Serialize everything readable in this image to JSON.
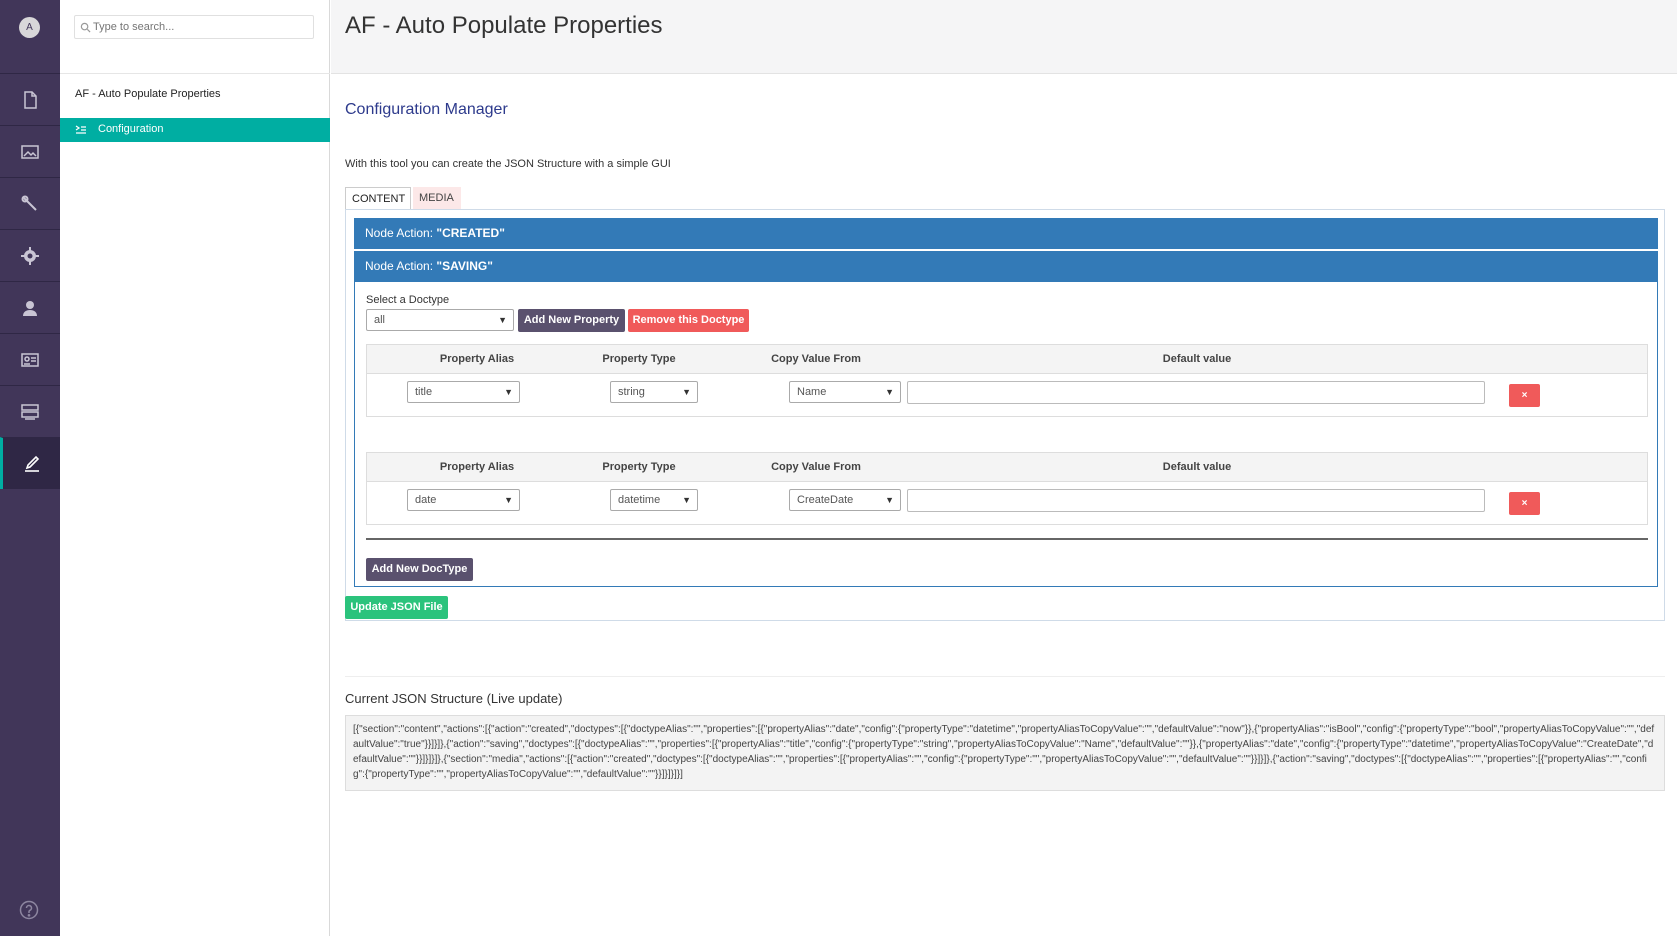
{
  "rail": {
    "avatar_letter": "A",
    "items": [
      {
        "icon": "content-icon"
      },
      {
        "icon": "media-icon"
      },
      {
        "icon": "settings-wrench-icon"
      },
      {
        "icon": "gear-icon"
      },
      {
        "icon": "user-icon"
      },
      {
        "icon": "members-icon"
      },
      {
        "icon": "forms-icon"
      },
      {
        "icon": "edit-pen-icon",
        "active": true
      }
    ],
    "help_icon": "help-icon"
  },
  "tree": {
    "search_placeholder": "Type to search...",
    "root_label": "AF - Auto Populate Properties",
    "active_item_label": "Configuration"
  },
  "header": {
    "title": "AF - Auto Populate Properties"
  },
  "main": {
    "section_title": "Configuration Manager",
    "intro_text": "With this tool you can create the JSON Structure with a simple GUI",
    "tabs": [
      {
        "label": "CONTENT",
        "active": true
      },
      {
        "label": "MEDIA",
        "active": false
      }
    ],
    "actions": [
      {
        "prefix": "Node Action: ",
        "name": "\"CREATED\""
      },
      {
        "prefix": "Node Action: ",
        "name": "\"SAVING\""
      }
    ],
    "doctype": {
      "label": "Select a Doctype",
      "selected": "all",
      "add_property_label": "Add New Property",
      "remove_doctype_label": "Remove this Doctype"
    },
    "table_headers": {
      "alias": "Property Alias",
      "type": "Property Type",
      "copy_from": "Copy Value From",
      "default": "Default value"
    },
    "properties": [
      {
        "alias": "title",
        "type": "string",
        "copy_from": "Name",
        "default": "",
        "delete": "×"
      },
      {
        "alias": "date",
        "type": "datetime",
        "copy_from": "CreateDate",
        "default": "",
        "delete": "×"
      }
    ],
    "add_doctype_label": "Add New DocType",
    "update_json_label": "Update JSON File",
    "json_title": "Current JSON Structure (Live update)",
    "json_text": "[{\"section\":\"content\",\"actions\":[{\"action\":\"created\",\"doctypes\":[{\"doctypeAlias\":\"\",\"properties\":[{\"propertyAlias\":\"date\",\"config\":{\"propertyType\":\"datetime\",\"propertyAliasToCopyValue\":\"\",\"defaultValue\":\"now\"}},{\"propertyAlias\":\"isBool\",\"config\":{\"propertyType\":\"bool\",\"propertyAliasToCopyValue\":\"\",\"defaultValue\":\"true\"}}]}]},{\"action\":\"saving\",\"doctypes\":[{\"doctypeAlias\":\"\",\"properties\":[{\"propertyAlias\":\"title\",\"config\":{\"propertyType\":\"string\",\"propertyAliasToCopyValue\":\"Name\",\"defaultValue\":\"\"}},{\"propertyAlias\":\"date\",\"config\":{\"propertyType\":\"datetime\",\"propertyAliasToCopyValue\":\"CreateDate\",\"defaultValue\":\"\"}}]}]}]},{\"section\":\"media\",\"actions\":[{\"action\":\"created\",\"doctypes\":[{\"doctypeAlias\":\"\",\"properties\":[{\"propertyAlias\":\"\",\"config\":{\"propertyType\":\"\",\"propertyAliasToCopyValue\":\"\",\"defaultValue\":\"\"}}]}]},{\"action\":\"saving\",\"doctypes\":[{\"doctypeAlias\":\"\",\"properties\":[{\"propertyAlias\":\"\",\"config\":{\"propertyType\":\"\",\"propertyAliasToCopyValue\":\"\",\"defaultValue\":\"\"}}]}]}]}]"
  },
  "colors": {
    "rail": "#413659",
    "accent": "#00aea2",
    "action_bar": "#337ab7",
    "danger": "#f05a5a",
    "success": "#2bc37c",
    "dark_button": "#5a516e"
  }
}
